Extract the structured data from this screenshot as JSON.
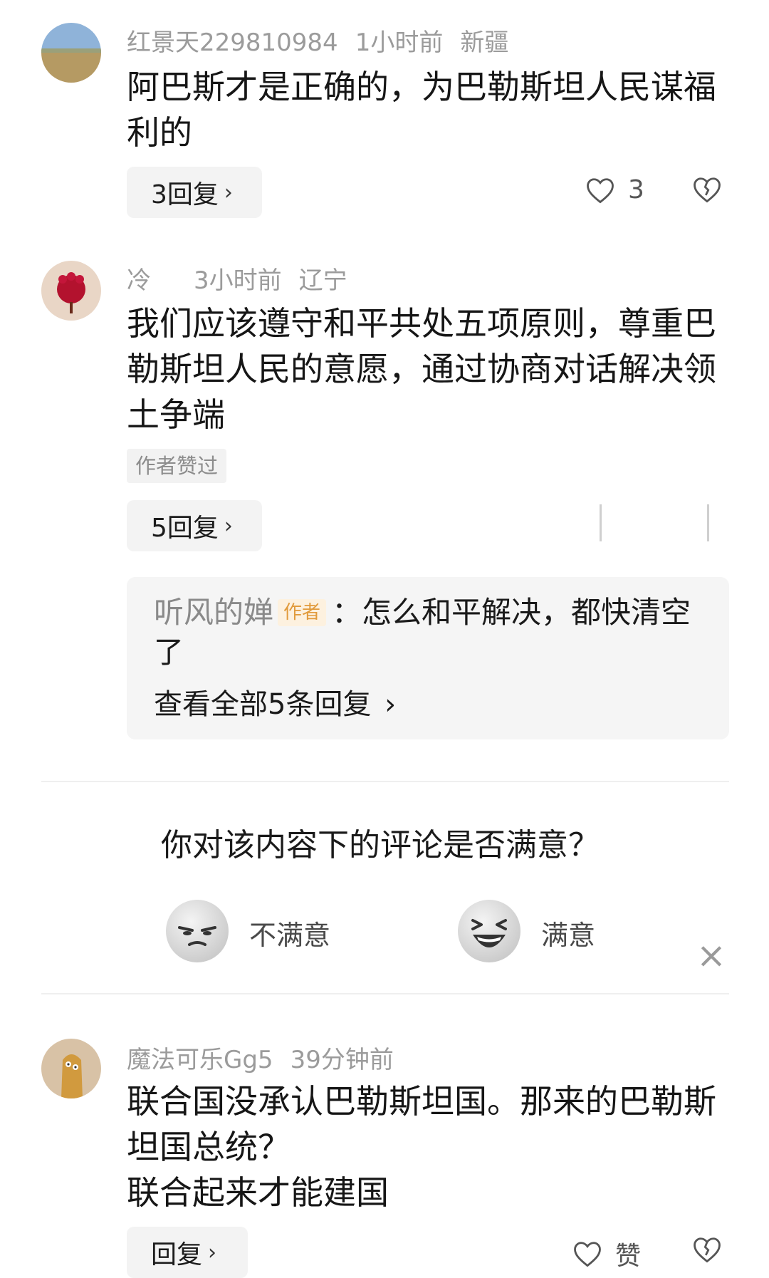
{
  "comments": [
    {
      "username": "红景天229810984",
      "time": "1小时前",
      "location": "新疆",
      "text": "阿巴斯才是正确的，为巴勒斯坦人民谋福利的",
      "reply_label": "3回复",
      "like_count": "3"
    },
    {
      "username": "冷",
      "time": "3小时前",
      "location": "辽宁",
      "text": "我们应该遵守和平共处五项原则，尊重巴勒斯坦人民的意愿，通过协商对话解决领土争端",
      "author_liked_tag": "作者赞过",
      "reply_label": "5回复",
      "sub_reply": {
        "name": "听风的婵",
        "badge": "作者",
        "separator": "：",
        "text": "怎么和平解决，都快清空了",
        "view_all": "查看全部5条回复"
      }
    },
    {
      "username": "魔法可乐Gg5",
      "time": "39分钟前",
      "text_line1": "联合国没承认巴勒斯坦国。那来的巴勒斯坦国总统？",
      "text_line2": "联合起来才能建国",
      "reply_label": "回复",
      "like_label": "赞"
    }
  ],
  "survey": {
    "question": "你对该内容下的评论是否满意？",
    "option_unsatisfied": "不满意",
    "option_satisfied": "满意"
  },
  "icons": {
    "chevron": "›",
    "close": "×"
  },
  "colors": {
    "meta_text": "#9b9b9b",
    "author_badge_bg": "#fdf1df",
    "author_badge_text": "#e19a3b",
    "panel_bg": "#f5f5f5"
  }
}
